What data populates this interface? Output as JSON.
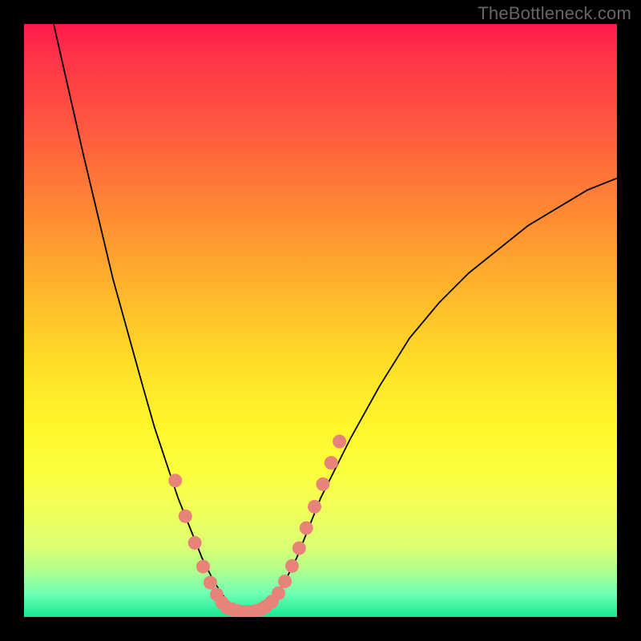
{
  "watermark": "TheBottleneck.com",
  "chart_data": {
    "type": "line",
    "title": "",
    "xlabel": "",
    "ylabel": "",
    "xlim": [
      0,
      100
    ],
    "ylim": [
      0,
      100
    ],
    "series": [
      {
        "name": "left-curve",
        "x": [
          5,
          10,
          15,
          20,
          22,
          24,
          26,
          28,
          30,
          32,
          34,
          35
        ],
        "y": [
          100,
          78,
          57,
          39,
          32,
          26,
          20,
          15,
          10,
          6,
          3,
          1.5
        ]
      },
      {
        "name": "right-curve",
        "x": [
          40,
          42,
          44,
          46,
          48,
          50,
          55,
          60,
          65,
          70,
          75,
          80,
          85,
          90,
          95,
          100
        ],
        "y": [
          1.5,
          3,
          6,
          10,
          15,
          20,
          30,
          39,
          47,
          53,
          58,
          62,
          66,
          69,
          72,
          74
        ]
      },
      {
        "name": "valley-floor",
        "x": [
          35,
          36,
          37,
          38,
          39,
          40
        ],
        "y": [
          1.5,
          1,
          1,
          1,
          1,
          1.5
        ]
      }
    ],
    "markers": [
      {
        "name": "left-salmon-anchors",
        "x": [
          25.5,
          27.2,
          28.8,
          30.2,
          31.4,
          32.5,
          33.4,
          34.2
        ],
        "y": [
          23,
          17,
          12.5,
          8.5,
          5.8,
          3.8,
          2.4,
          1.6
        ]
      },
      {
        "name": "right-salmon-anchors",
        "x": [
          40.8,
          41.8,
          42.9,
          44.0,
          45.2,
          46.4,
          47.6,
          49.0,
          50.4,
          51.8,
          53.2
        ],
        "y": [
          1.8,
          2.6,
          4.0,
          6.0,
          8.6,
          11.6,
          15.0,
          18.6,
          22.4,
          26.0,
          29.6
        ]
      },
      {
        "name": "floor-salmon-anchors",
        "x": [
          35.0,
          36.0,
          37.0,
          38.0,
          39.0,
          40.0
        ],
        "y": [
          1.3,
          1.0,
          0.9,
          0.9,
          1.0,
          1.3
        ]
      }
    ],
    "colors": {
      "curve": "#000000",
      "marker_fill": "#e8837a",
      "marker_stroke": "#e8837a"
    }
  }
}
